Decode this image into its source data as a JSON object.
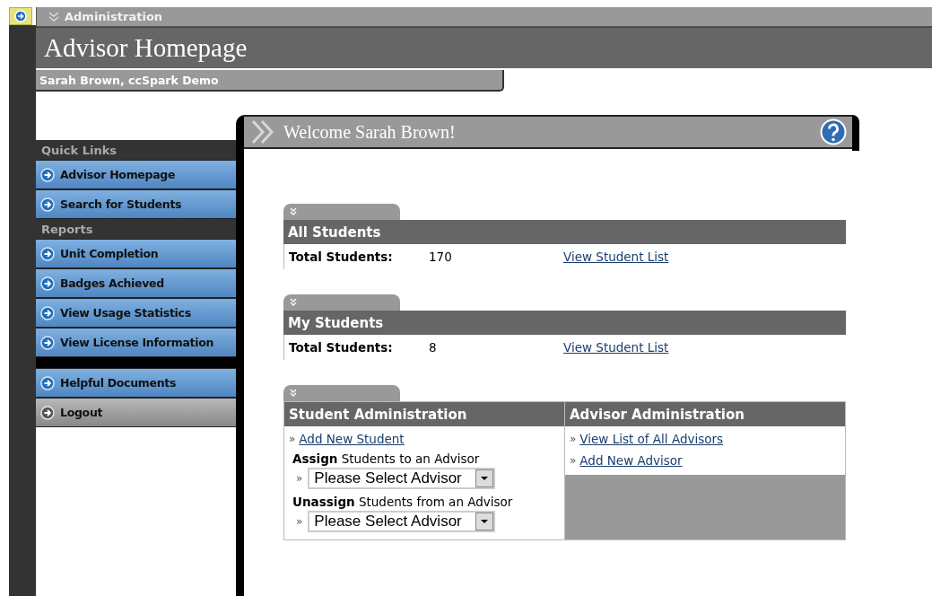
{
  "admin_bar": {
    "label": "Administration"
  },
  "page_title": "Advisor Homepage",
  "user_bar": "Sarah Brown, ccSpark Demo",
  "sidebar": {
    "groups": [
      {
        "heading": "Quick Links",
        "items": [
          {
            "label": "Advisor Homepage",
            "kind": "link"
          },
          {
            "label": "Search for Students",
            "kind": "link"
          }
        ]
      },
      {
        "heading": "Reports",
        "items": [
          {
            "label": "Unit Completion",
            "kind": "link"
          },
          {
            "label": "Badges Achieved",
            "kind": "link"
          },
          {
            "label": "View Usage Statistics",
            "kind": "link"
          },
          {
            "label": "View License Information",
            "kind": "link"
          }
        ]
      },
      {
        "items": [
          {
            "label": "Helpful Documents",
            "kind": "link"
          },
          {
            "label": "Logout",
            "kind": "logout"
          }
        ]
      }
    ]
  },
  "welcome": "Welcome Sarah Brown!",
  "stat_sections": [
    {
      "title": "All Students",
      "label": "Total Students:",
      "value": "170",
      "link": "View Student List"
    },
    {
      "title": "My Students",
      "label": "Total Students:",
      "value": "8",
      "link": "View Student List"
    }
  ],
  "admin_section": {
    "student": {
      "title": "Student Administration",
      "links": [
        {
          "bullet": "»",
          "label": "Add New Student"
        }
      ],
      "selects": [
        {
          "caption": "**Assign** Students to an Advisor",
          "bullet": "»",
          "value": "Please Select Advisor"
        },
        {
          "caption": "**Unassign** Students from an Advisor",
          "bullet": "»",
          "value": "Please Select Advisor"
        }
      ]
    },
    "advisor": {
      "title": "Advisor Administration",
      "links": [
        {
          "bullet": "»",
          "label": "View List of All Advisors"
        },
        {
          "bullet": "»",
          "label": "Add New Advisor"
        }
      ]
    }
  }
}
